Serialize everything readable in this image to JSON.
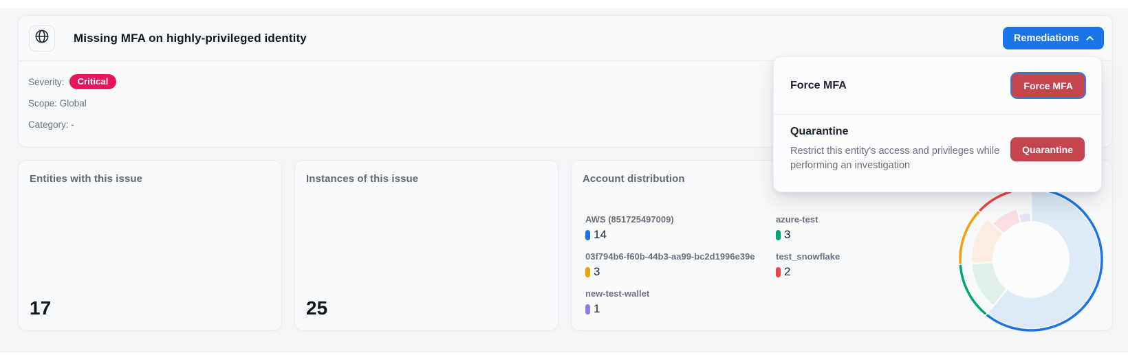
{
  "header": {
    "title": "Missing MFA on highly-privileged identity",
    "remediations_label": "Remediations"
  },
  "info": {
    "severity_label": "Severity:",
    "severity_value": "Critical",
    "severity_color": "#e8155a",
    "scope": "Scope: Global",
    "category": "Category: -"
  },
  "dropdown": {
    "items": [
      {
        "title": "Force MFA",
        "button": "Force MFA"
      },
      {
        "title": "Quarantine",
        "description": "Restrict this entity's access and privileges while performing an investigation",
        "button": "Quarantine"
      }
    ]
  },
  "cards": {
    "entities": {
      "title": "Entities with this issue",
      "value": "17"
    },
    "instances": {
      "title": "Instances of this issue",
      "value": "25"
    },
    "distribution": {
      "title": "Account distribution"
    }
  },
  "chart_data": {
    "type": "pie",
    "title": "Account distribution",
    "donut": true,
    "start_angle_deg": 0,
    "clockwise": true,
    "total": 23,
    "series": [
      {
        "label": "AWS (851725497009)",
        "value": 14,
        "color": "#1a73e8",
        "fill": "#deeaf7",
        "fill_radius": 101
      },
      {
        "label": "azure-test",
        "value": 3,
        "color": "#00a571",
        "fill": "#dff0e8",
        "fill_radius": 87
      },
      {
        "label": "03f794b6-f60b-44b3-aa99-bc2d1996e39e",
        "value": 3,
        "color": "#f59e0b",
        "fill": "#fbede0",
        "fill_radius": 87
      },
      {
        "label": "test_snowflake",
        "value": 2,
        "color": "#ef4444",
        "fill": "#fae0e3",
        "fill_radius": 77
      },
      {
        "label": "new-test-wallet",
        "value": 1,
        "color": "#8b7cf6",
        "fill": "#e6e3f9",
        "fill_radius": 68
      }
    ],
    "outer_arc_radius": 103,
    "hole_radius": 56,
    "legend_position": "left",
    "values_shown_in_legend": [
      14,
      3,
      3,
      2,
      1
    ]
  }
}
